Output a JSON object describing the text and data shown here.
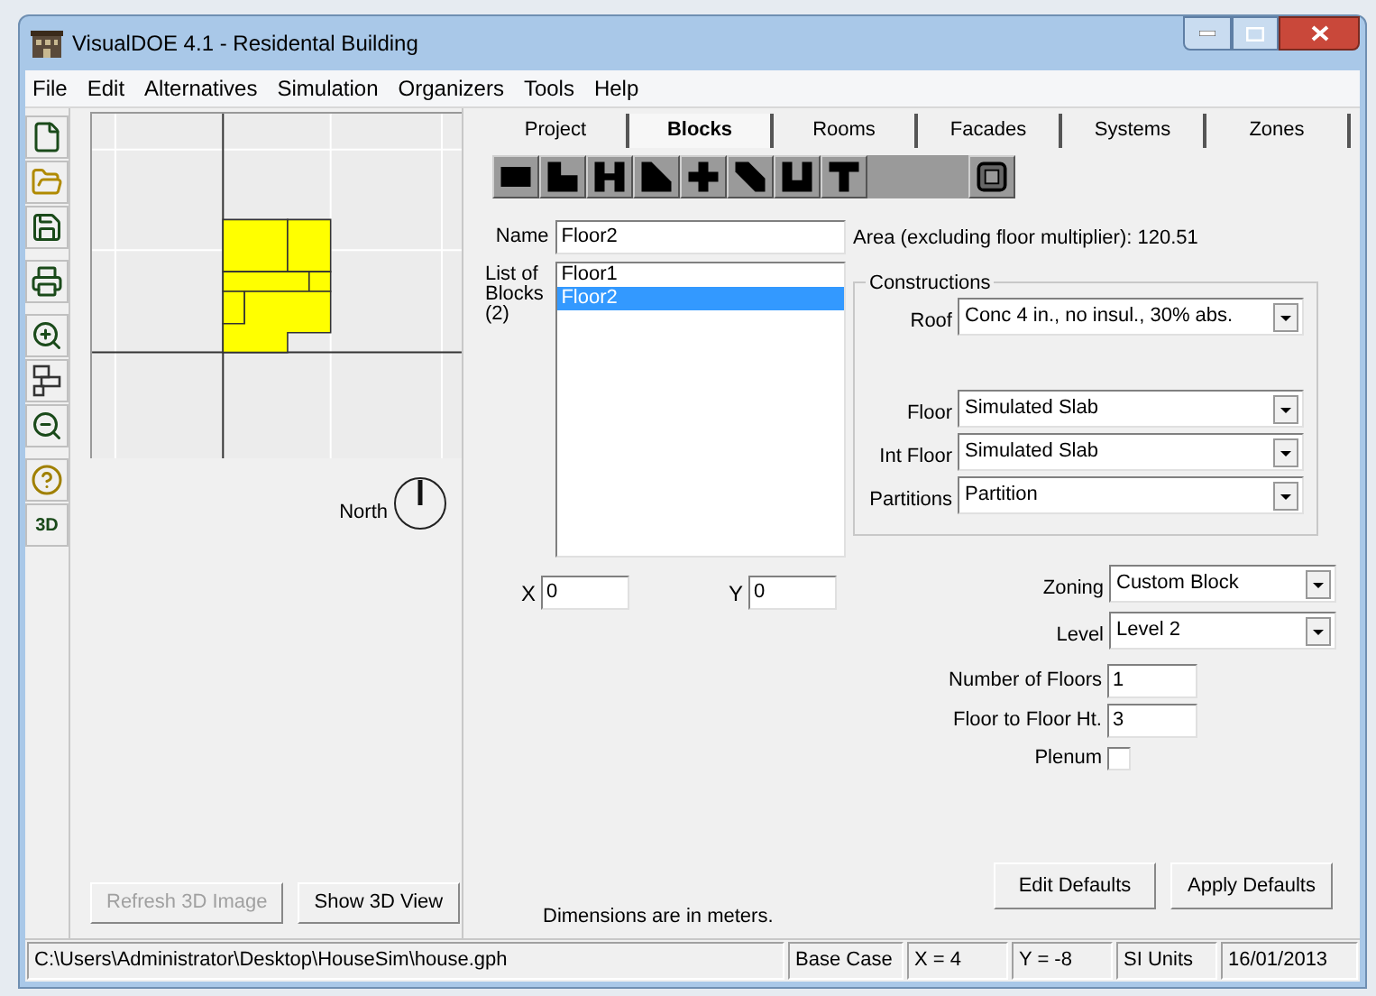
{
  "window": {
    "title": "VisualDOE 4.1 - Residental Building"
  },
  "menu": [
    "File",
    "Edit",
    "Alternatives",
    "Simulation",
    "Organizers",
    "Tools",
    "Help"
  ],
  "toolbar": [
    {
      "kind": "new"
    },
    {
      "kind": "open"
    },
    {
      "kind": "save"
    },
    {
      "kind": "print"
    },
    {
      "kind": "zoom-in"
    },
    {
      "kind": "fit"
    },
    {
      "kind": "zoom-out"
    },
    {
      "kind": "help"
    },
    {
      "kind": "text",
      "label": "3D"
    }
  ],
  "plan": {
    "north_label": "North"
  },
  "left_buttons": [
    {
      "label": "Refresh 3D Image",
      "disabled": true
    },
    {
      "label": "Show 3D View",
      "disabled": false
    }
  ],
  "tabs": [
    {
      "label": "Project",
      "selected": false
    },
    {
      "label": "Blocks",
      "selected": true
    },
    {
      "label": "Rooms",
      "selected": false
    },
    {
      "label": "Facades",
      "selected": false
    },
    {
      "label": "Systems",
      "selected": false
    },
    {
      "label": "Zones",
      "selected": false
    }
  ],
  "shapes": [
    {
      "kind": "rect"
    },
    {
      "kind": "l"
    },
    {
      "kind": "h"
    },
    {
      "kind": "triangle"
    },
    {
      "kind": "cross"
    },
    {
      "kind": "diagonal"
    },
    {
      "kind": "u"
    },
    {
      "kind": "t"
    },
    {
      "kind": "gap"
    },
    {
      "kind": "custom"
    }
  ],
  "name": {
    "label": "Name",
    "value": "Floor2"
  },
  "area_text": "Area (excluding floor multiplier): 120.51",
  "blocks_list": {
    "label": [
      "List of",
      "Blocks",
      "(2)"
    ],
    "items": [
      {
        "label": "Floor1",
        "selected": false
      },
      {
        "label": "Floor2",
        "selected": true
      }
    ]
  },
  "constructions": {
    "title": "Constructions",
    "rows": [
      {
        "label": "Roof",
        "value": "Conc 4 in., no insul., 30% abs."
      },
      {
        "label": "Floor",
        "value": "Simulated Slab"
      },
      {
        "label": "Int Floor",
        "value": "Simulated Slab"
      },
      {
        "label": "Partitions",
        "value": "Partition"
      }
    ]
  },
  "position": [
    {
      "label": "X",
      "value": "0"
    },
    {
      "label": "Y",
      "value": "0"
    }
  ],
  "zoning": [
    {
      "label": "Zoning",
      "value": "Custom Block"
    },
    {
      "label": "Level",
      "value": "Level 2"
    }
  ],
  "floors": [
    {
      "label": "Number of Floors",
      "value": "1"
    },
    {
      "label": "Floor to Floor Ht.",
      "value": "3"
    }
  ],
  "plenum": {
    "label": "Plenum",
    "checked": false
  },
  "note": "Dimensions are in meters.",
  "default_buttons": [
    "Edit Defaults",
    "Apply Defaults"
  ],
  "status_bar": [
    "C:\\Users\\Administrator\\Desktop\\HouseSim\\house.gph",
    "Base Case",
    "X = 4",
    "Y = -8",
    "SI Units",
    "16/01/2013"
  ]
}
